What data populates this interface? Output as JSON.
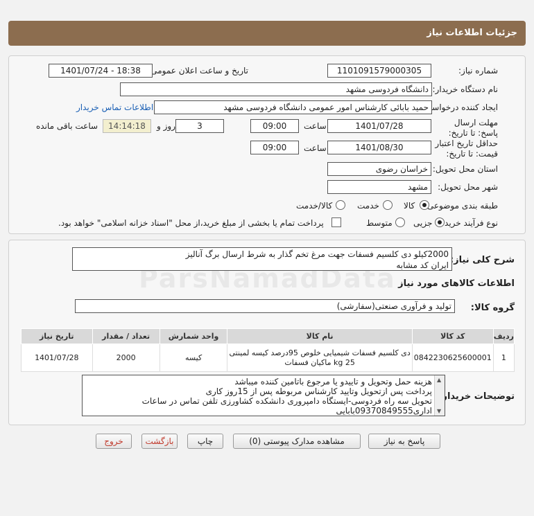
{
  "header": {
    "title": "جزئیات اطلاعات نیاز"
  },
  "form": {
    "need_number_label": "شماره نیاز:",
    "need_number": "1101091579000305",
    "announce_label": "تاریخ و ساعت اعلان عمومی:",
    "announce_value": "1401/07/24 - 18:38",
    "buyer_org_label": "نام دستگاه خریدار:",
    "buyer_org": "دانشگاه فردوسی مشهد",
    "requester_label": "ایجاد کننده درخواست:",
    "requester": "حمید بابائی کارشناس امور عمومی دانشگاه فردوسی مشهد",
    "contact_link": "اطلاعات تماس خریدار",
    "deadline_label": "مهلت ارسال پاسخ: تا تاریخ:",
    "deadline_date": "1401/07/28",
    "time_label": "ساعت",
    "deadline_time": "09:00",
    "days": "3",
    "days_label": "روز و",
    "remaining_time": "14:14:18",
    "remaining_label": "ساعت باقی مانده",
    "validity_label": "حداقل تاریخ اعتبار قیمت: تا تاریخ:",
    "validity_date": "1401/08/30",
    "validity_time": "09:00",
    "province_label": "استان محل تحویل:",
    "province": "خراسان رضوی",
    "city_label": "شهر محل تحویل:",
    "city": "مشهد",
    "category_label": "طبقه بندی موضوعی:",
    "category_options": [
      "کالا",
      "خدمت",
      "کالا/خدمت"
    ],
    "category_selected": "کالا",
    "process_label": "نوع فرآیند خرید :",
    "process_options": [
      "جزیی",
      "متوسط"
    ],
    "process_selected": "جزیی",
    "payment_note": "پرداخت تمام یا بخشی از مبلغ خرید،از محل \"اسناد خزانه اسلامی\" خواهد بود."
  },
  "description": {
    "label": "شرح کلی نیاز:",
    "line1": "2000کیلو دی کلسیم فسفات جهت مرغ تخم گذار به شرط ارسال برگ آنالیز",
    "line2": "ایران کد مشابه"
  },
  "goods": {
    "section_title": "اطلاعات کالاهای مورد نیاز",
    "group_label": "گروه کالا:",
    "group_value": "تولید و فرآوری صنعتی(سفارشی)",
    "columns": [
      "ردیف",
      "کد کالا",
      "نام کالا",
      "واحد شمارش",
      "تعداد / مقدار",
      "تاریخ نیاز"
    ],
    "rows": [
      {
        "index": "1",
        "code": "0842230625600001",
        "name_line1": "دی کلسیم فسفات شیمیایی خلوص 95درصد کیسه لمینتی",
        "name_line2": "25 kg ماکیان فسفات",
        "unit": "کیسه",
        "qty": "2000",
        "date": "1401/07/28"
      }
    ]
  },
  "buyer_notes": {
    "label": "توضیحات خریدار:",
    "line1": "هزینه حمل وتحویل و تاییدو یا مرجوع باتامین کننده میباشد",
    "line2": "پرداخت پس ازتحویل وتایید کارشناس مربوطه پس از 15روز کاری",
    "line3": "تحویل سه راه فردوسی-ایستگاه دامپروری دانشکده کشاورزی تلفن تماس در ساعات",
    "line4": "اداری09370849555بابایی"
  },
  "buttons": {
    "reply": "پاسخ به نیاز",
    "attachments": "مشاهده مدارک پیوستی (0)",
    "print": "چاپ",
    "back": "بازگشت",
    "exit": "خروج"
  }
}
